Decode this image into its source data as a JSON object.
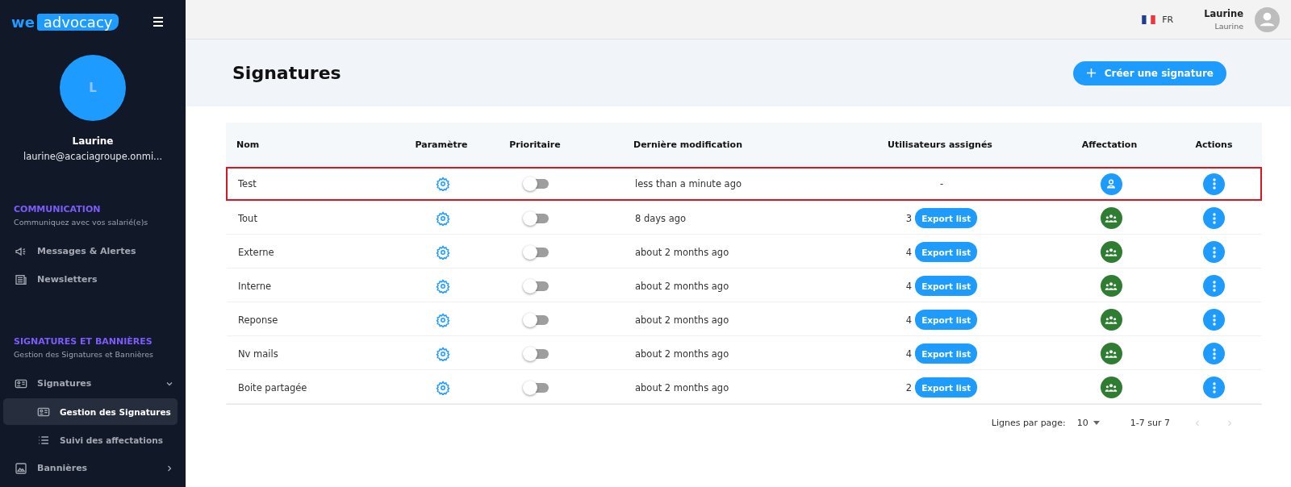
{
  "sidebar": {
    "logo": {
      "part_1": "we",
      "part_2": "advocacy"
    },
    "avatar": "L",
    "user_name": "Laurine",
    "user_email": "laurine@acaciagroupe.onmi...",
    "sections": [
      {
        "title": "COMMUNICATION",
        "subtitle": "Communiquez avec vos salarié(e)s",
        "items": [
          {
            "label": "Messages & Alertes",
            "kind": "megaphone",
            "selected": false
          },
          {
            "label": "Newsletters",
            "kind": "news",
            "selected": false
          }
        ]
      },
      {
        "title": "SIGNATURES ET BANNIÈRES",
        "subtitle": "Gestion des Signatures et Bannières",
        "items": [
          {
            "label": "Signatures",
            "kind": "card",
            "selected": false,
            "expanded": true,
            "children": [
              {
                "label": "Gestion des Signatures",
                "kind": "card",
                "selected": true
              },
              {
                "label": "Suivi des affectations",
                "kind": "list",
                "selected": false
              }
            ]
          },
          {
            "label": "Bannières",
            "kind": "image",
            "selected": false,
            "expanded": false
          }
        ]
      }
    ]
  },
  "topbar": {
    "language": "FR",
    "user_name": "Laurine",
    "user_role": "Laurine"
  },
  "page": {
    "title": "Signatures",
    "create_button": "Créer une signature"
  },
  "table": {
    "columns": [
      "Nom",
      "Paramètre",
      "Prioritaire",
      "Dernière modification",
      "Utilisateurs assignés",
      "Affectation",
      "Actions"
    ],
    "rows": [
      {
        "name": "Test",
        "priority_on": false,
        "modified": "less than a minute ago",
        "no_users": "-",
        "kind": "single",
        "highlighted": true
      },
      {
        "name": "Tout",
        "priority_on": false,
        "modified": "8 days ago",
        "users": "3",
        "export": "Export list",
        "kind": "group",
        "highlighted": false
      },
      {
        "name": "Externe",
        "priority_on": false,
        "modified": "about 2 months ago",
        "users": "4",
        "export": "Export list",
        "kind": "group",
        "highlighted": false
      },
      {
        "name": "Interne",
        "priority_on": false,
        "modified": "about 2 months ago",
        "users": "4",
        "export": "Export list",
        "kind": "group",
        "highlighted": false
      },
      {
        "name": "Reponse",
        "priority_on": false,
        "modified": "about 2 months ago",
        "users": "4",
        "export": "Export list",
        "kind": "group",
        "highlighted": false
      },
      {
        "name": "Nv mails",
        "priority_on": false,
        "modified": "about 2 months ago",
        "users": "4",
        "export": "Export list",
        "kind": "group",
        "highlighted": false
      },
      {
        "name": "Boite partagée",
        "priority_on": false,
        "modified": "about 2 months ago",
        "users": "2",
        "export": "Export list",
        "kind": "group",
        "highlighted": false
      }
    ]
  },
  "pagination": {
    "rows_label": "Lignes par page:",
    "rows_value": "10",
    "range": "1-7 sur 7",
    "prev_disabled": true,
    "next_disabled": true
  }
}
